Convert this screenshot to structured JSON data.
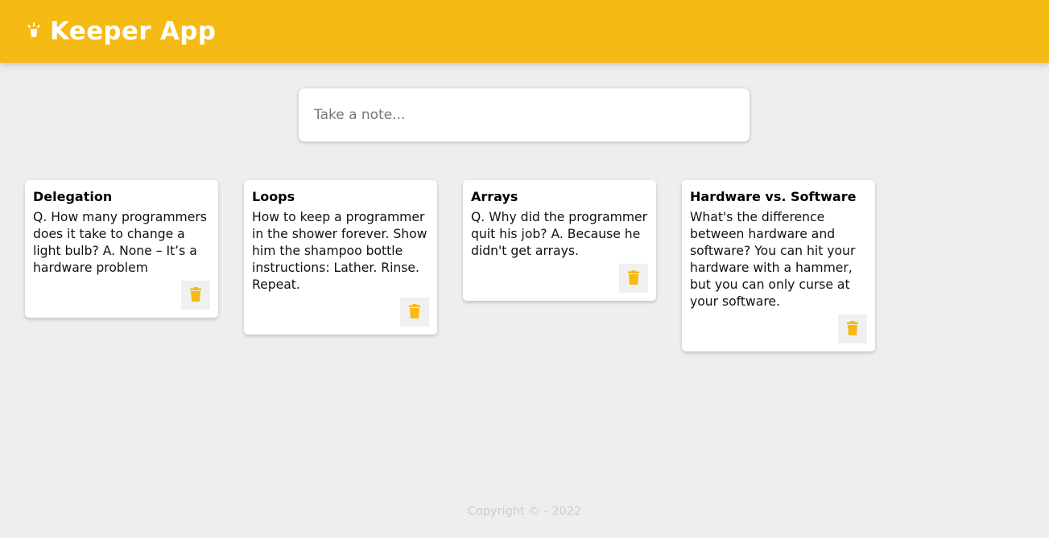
{
  "header": {
    "title": "Keeper App",
    "icon": "highlight-lamp-icon",
    "background": "#f5ba13"
  },
  "create_note": {
    "placeholder": "Take a note...",
    "value": ""
  },
  "notes": [
    {
      "title": "Delegation",
      "content": "Q. How many programmers does it take to change a light bulb? A. None – It’s a hardware problem",
      "delete_icon": "trash-icon"
    },
    {
      "title": "Loops",
      "content": "How to keep a programmer in the shower forever. Show him the shampoo bottle instructions: Lather. Rinse. Repeat.",
      "delete_icon": "trash-icon"
    },
    {
      "title": "Arrays",
      "content": "Q. Why did the programmer quit his job? A. Because he didn't get arrays.",
      "delete_icon": "trash-icon"
    },
    {
      "title": "Hardware vs. Software",
      "content": "What's the difference between hardware and software? You can hit your hardware with a hammer, but you can only curse at your software.",
      "delete_icon": "trash-icon"
    }
  ],
  "footer": {
    "text": "Copyright © - 2022"
  },
  "colors": {
    "accent": "#f5ba13",
    "background": "#eeeeee"
  }
}
